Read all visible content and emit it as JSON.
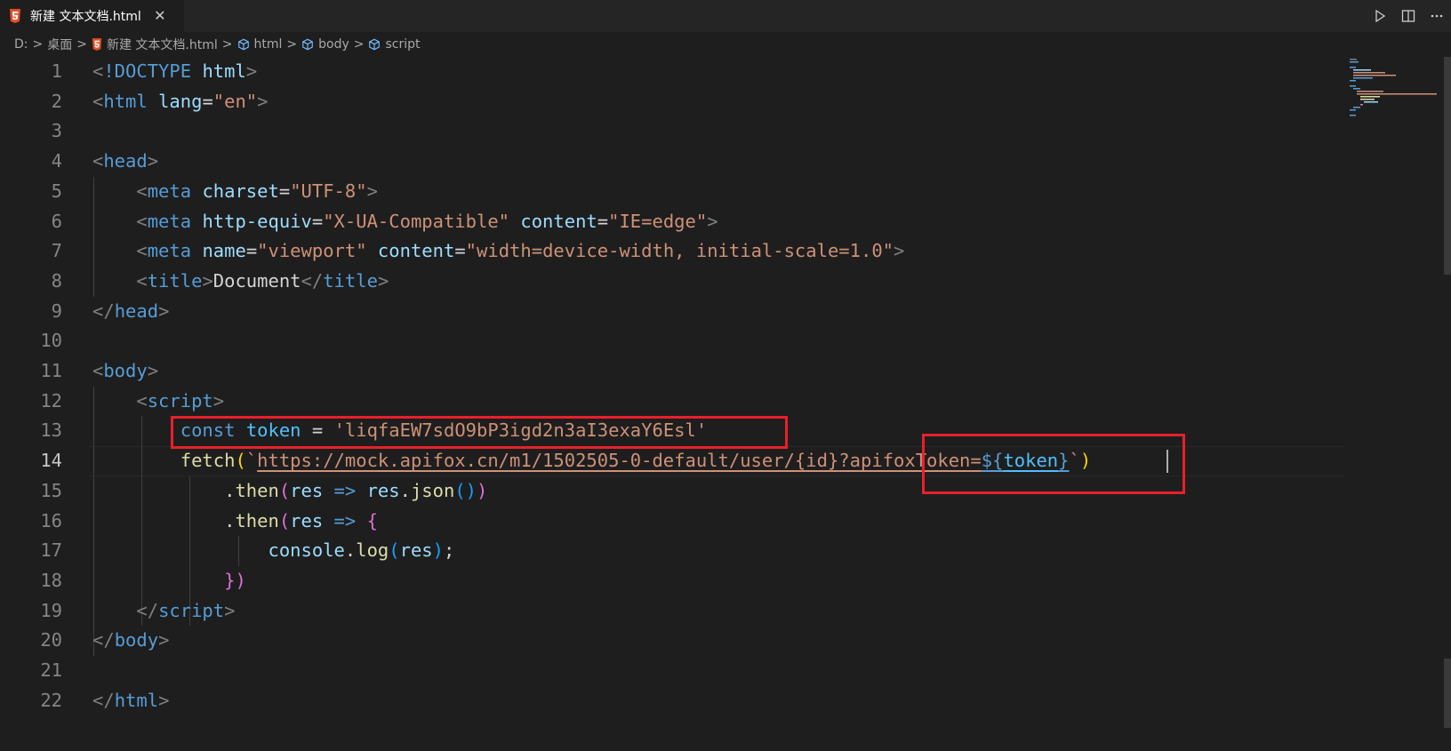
{
  "tab": {
    "title": "新建 文本文档.html",
    "close_glyph": "✕"
  },
  "breadcrumb": {
    "items": [
      "D:",
      "桌面",
      "新建 文本文档.html",
      "html",
      "body",
      "script"
    ],
    "separator": ">"
  },
  "editor": {
    "line_numbers": [
      "1",
      "2",
      "3",
      "4",
      "5",
      "6",
      "7",
      "8",
      "9",
      "10",
      "11",
      "12",
      "13",
      "14",
      "15",
      "16",
      "17",
      "18",
      "19",
      "20",
      "21",
      "22"
    ],
    "active_line": "14",
    "lines": {
      "l1": {
        "lt": "<",
        "doctype": "!DOCTYPE",
        "html": "html",
        "gt": ">"
      },
      "l2": {
        "lt": "<",
        "tag": "html",
        "attr": "lang",
        "eq": "=",
        "val": "\"en\"",
        "gt": ">"
      },
      "l4": {
        "lt": "<",
        "tag": "head",
        "gt": ">"
      },
      "l5": {
        "lt": "<",
        "tag": "meta",
        "attr": "charset",
        "eq": "=",
        "val": "\"UTF-8\"",
        "gt": ">"
      },
      "l6": {
        "lt": "<",
        "tag": "meta",
        "attr1": "http-equiv",
        "eq1": "=",
        "val1": "\"X-UA-Compatible\"",
        "attr2": "content",
        "eq2": "=",
        "val2": "\"IE=edge\"",
        "gt": ">"
      },
      "l7": {
        "lt": "<",
        "tag": "meta",
        "attr1": "name",
        "eq1": "=",
        "val1": "\"viewport\"",
        "attr2": "content",
        "eq2": "=",
        "val2": "\"width=device-width, initial-scale=1.0\"",
        "gt": ">"
      },
      "l8": {
        "lt1": "<",
        "tag1": "title",
        "gt1": ">",
        "text": "Document",
        "lt2": "</",
        "tag2": "title",
        "gt2": ">"
      },
      "l9": {
        "lt": "</",
        "tag": "head",
        "gt": ">"
      },
      "l11": {
        "lt": "<",
        "tag": "body",
        "gt": ">"
      },
      "l12": {
        "lt": "<",
        "tag": "script",
        "gt": ">"
      },
      "l13": {
        "kw": "const",
        "var": "token",
        "op": " = ",
        "str": "'liqfaEW7sdO9bP3igd2n3aI3exaY6Esl'"
      },
      "l14": {
        "fn": "fetch",
        "p1": "(",
        "tick": "`",
        "url": "https://mock.apifox.cn/m1/1502505-0-default/user/{id}",
        "qs": "?apifoxToken=",
        "tmpl_open": "${",
        "tvar": "token",
        "tmpl_close": "}",
        "tick2": "`",
        "p1c": ")"
      },
      "l15": {
        "dot": ".",
        "fn": "then",
        "p": "(",
        "param": "res",
        "arrow": " => ",
        "obj": "res",
        "dot2": ".",
        "fn2": "json",
        "p2": "()",
        "pc": ")"
      },
      "l16": {
        "dot": ".",
        "fn": "then",
        "p": "(",
        "param": "res",
        "arrow": " => ",
        "brace": "{"
      },
      "l17": {
        "obj": "console",
        "dot": ".",
        "fn": "log",
        "p": "(",
        "arg": "res",
        "pc": ")",
        "semi": ";"
      },
      "l18": {
        "brace": "}",
        "pc": ")"
      },
      "l19": {
        "lt": "</",
        "tag": "script",
        "gt": ">"
      },
      "l20": {
        "lt": "</",
        "tag": "body",
        "gt": ">"
      },
      "l22": {
        "lt": "</",
        "tag": "html",
        "gt": ">"
      }
    }
  },
  "colors": {
    "highlight_box": "#e8202a",
    "background": "#1e1e1e"
  }
}
